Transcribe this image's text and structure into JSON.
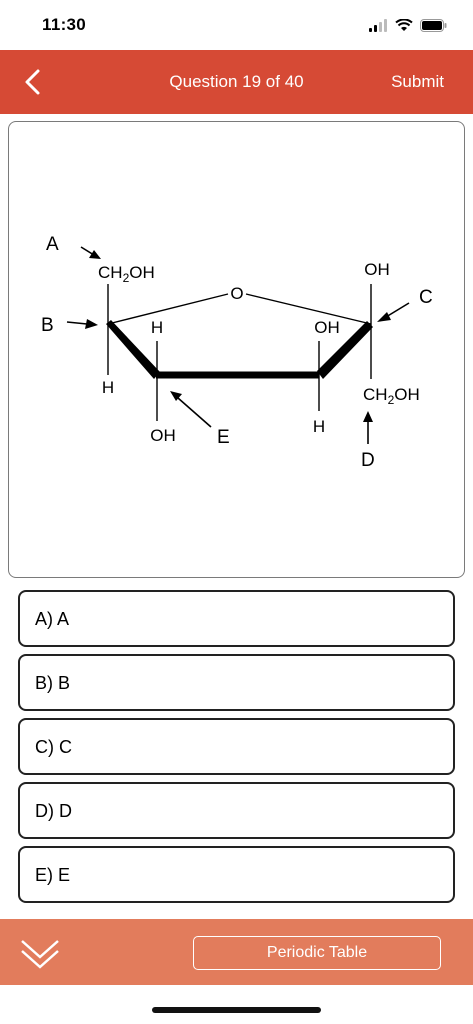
{
  "status_bar": {
    "time": "11:30"
  },
  "nav": {
    "title": "Question 19 of 40",
    "submit_label": "Submit"
  },
  "structure": {
    "labels": {
      "a": "A",
      "b": "B",
      "c": "C",
      "d": "D",
      "e": "E"
    },
    "ring_oxygen": "O",
    "ch2oh_prefix": "CH",
    "ch2oh_subscript": "2",
    "ch2oh_suffix": "OH",
    "hydroxyl": "OH",
    "hydrogen": "H"
  },
  "answers": [
    {
      "label": "A) A"
    },
    {
      "label": "B) B"
    },
    {
      "label": "C) C"
    },
    {
      "label": "D) D"
    },
    {
      "label": "E) E"
    }
  ],
  "footer": {
    "periodic_table_label": "Periodic Table"
  },
  "colors": {
    "header": "#d64a35",
    "footer": "#e27c5c"
  },
  "icons": [
    "back-chevron-icon",
    "signal-icon",
    "wifi-icon",
    "battery-icon",
    "double-chevron-down-icon"
  ]
}
